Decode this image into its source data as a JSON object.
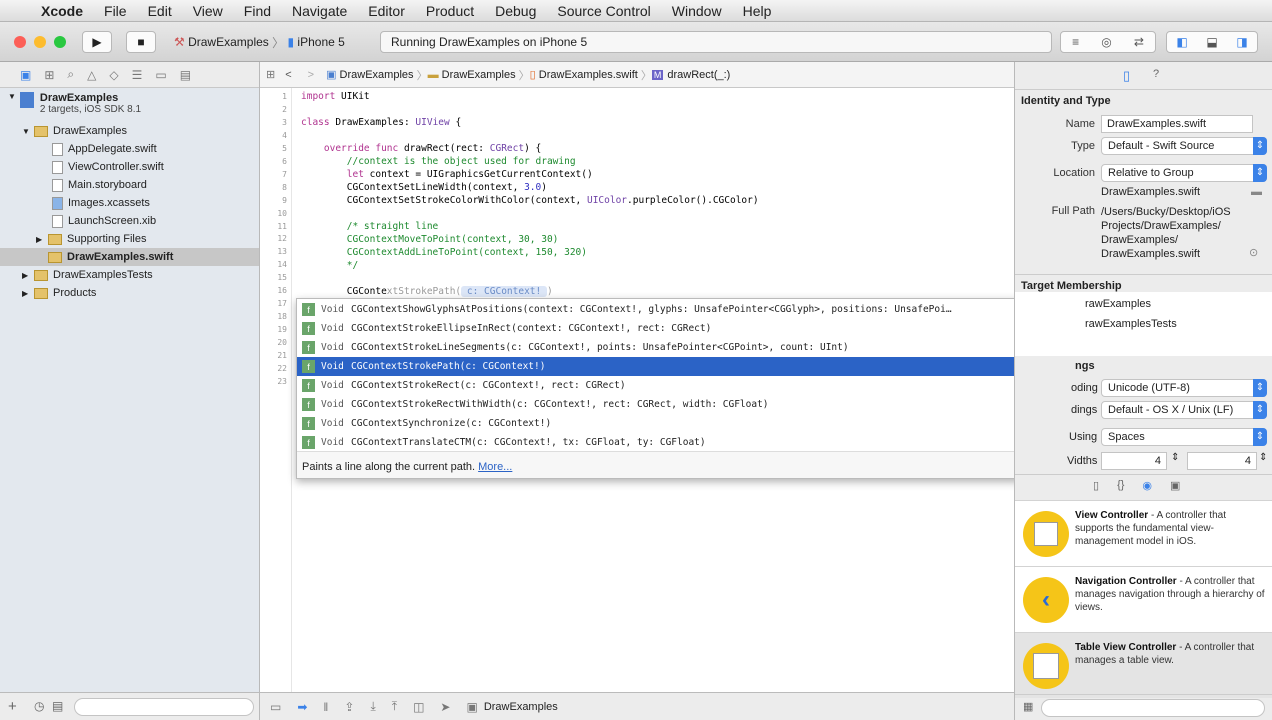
{
  "menubar": {
    "items": [
      "Xcode",
      "File",
      "Edit",
      "View",
      "Find",
      "Navigate",
      "Editor",
      "Product",
      "Debug",
      "Source Control",
      "Window",
      "Help"
    ]
  },
  "toolbar": {
    "scheme": "DrawExamples",
    "device": "iPhone 5",
    "status": "Running DrawExamples on iPhone 5"
  },
  "navigator": {
    "project": "DrawExamples",
    "project_sub": "2 targets, iOS SDK 8.1",
    "items": [
      {
        "label": "DrawExamples",
        "type": "folder"
      },
      {
        "label": "AppDelegate.swift",
        "type": "file"
      },
      {
        "label": "ViewController.swift",
        "type": "file"
      },
      {
        "label": "Main.storyboard",
        "type": "file"
      },
      {
        "label": "Images.xcassets",
        "type": "file"
      },
      {
        "label": "LaunchScreen.xib",
        "type": "file"
      },
      {
        "label": "Supporting Files",
        "type": "folder"
      },
      {
        "label": "DrawExamples.swift",
        "type": "file"
      },
      {
        "label": "DrawExamplesTests",
        "type": "folder"
      },
      {
        "label": "Products",
        "type": "folder"
      }
    ]
  },
  "jumpbar": [
    "DrawExamples",
    "DrawExamples",
    "DrawExamples.swift",
    "drawRect(_:)"
  ],
  "code": {
    "line_numbers": [
      "1",
      "2",
      "3",
      "4",
      "5",
      "6",
      "7",
      "8",
      "9",
      "10",
      "11",
      "12",
      "13",
      "14",
      "15",
      "16",
      "17",
      "18",
      "19",
      "20",
      "21",
      "22",
      "23"
    ],
    "l1a": "import",
    "l1b": " UIKit",
    "l3a": "class",
    "l3b": " DrawExamples: ",
    "l3c": "UIView",
    " l3d": " {",
    "l5a": "    override func",
    "l5b": " drawRect(rect: ",
    "l5c": "CGRect",
    "l5d": ") {",
    "l6": "        //context is the object used for drawing",
    "l7a": "        let",
    "l7b": " context = UIGraphicsGetCurrentContext()",
    "l8a": "        CGContextSetLineWidth(context, ",
    "l8b": "3.0",
    "l8c": ")",
    "l9a": "        CGContextSetStrokeColorWithColor(context, ",
    "l9b": "UIColor",
    "l9c": ".purpleColor().CGColor)",
    "l11": "        /* straight line",
    "l12": "        CGContextMoveToPoint(context, 30, 30)",
    "l13": "        CGContextAddLineToPoint(context, 150, 320)",
    "l14": "        */",
    "l16a": "        CGConte",
    "l16b": "xtStrokePath(",
    "l16c": " c: CGContext! ",
    "l16d": ")"
  },
  "autocomplete": {
    "items": [
      {
        "ret": "Void",
        "sig": "CGContextShowGlyphsAtPositions(context: CGContext!, glyphs: UnsafePointer<CGGlyph>, positions: UnsafePoi…"
      },
      {
        "ret": "Void",
        "sig": "CGContextStrokeEllipseInRect(context: CGContext!, rect: CGRect)"
      },
      {
        "ret": "Void",
        "sig": "CGContextStrokeLineSegments(c: CGContext!, points: UnsafePointer<CGPoint>, count: UInt)"
      },
      {
        "ret": "Void",
        "sig": "CGContextStrokePath(c: CGContext!)"
      },
      {
        "ret": "Void",
        "sig": "CGContextStrokeRect(c: CGContext!, rect: CGRect)"
      },
      {
        "ret": "Void",
        "sig": "CGContextStrokeRectWithWidth(c: CGContext!, rect: CGRect, width: CGFloat)"
      },
      {
        "ret": "Void",
        "sig": "CGContextSynchronize(c: CGContext!)"
      },
      {
        "ret": "Void",
        "sig": "CGContextTranslateCTM(c: CGContext!, tx: CGFloat, ty: CGFloat)"
      }
    ],
    "badge": "f",
    "description": "Paints a line along the current path.",
    "more": "More..."
  },
  "editor_bottom": {
    "target": "DrawExamples"
  },
  "inspector": {
    "identity_title": "Identity and Type",
    "name_label": "Name",
    "name": "DrawExamples.swift",
    "type_label": "Type",
    "type": "Default - Swift Source",
    "location_label": "Location",
    "location": "Relative to Group",
    "location_file": "DrawExamples.swift",
    "fullpath_label": "Full Path",
    "fullpath": [
      "/Users/Bucky/Desktop/iOS",
      "Projects/DrawExamples/",
      "DrawExamples/",
      "DrawExamples.swift"
    ],
    "target_title": "Target Membership",
    "targets": [
      "rawExamples",
      "rawExamplesTests"
    ],
    "text_title": "ngs",
    "encoding_label": "oding",
    "encoding": "Unicode (UTF-8)",
    "endings_label": "dings",
    "endings": "Default - OS X / Unix (LF)",
    "indent_label": "Using",
    "indent": "Spaces",
    "widths_label": "Vidths",
    "tab_width": "4",
    "indent_width": "4"
  },
  "library": [
    {
      "title": "View Controller",
      "desc": " - A controller that supports the fundamental view-management model in iOS."
    },
    {
      "title": "Navigation Controller",
      "desc": " - A controller that manages navigation through a hierarchy of views."
    },
    {
      "title": "Table View Controller",
      "desc": " - A controller that manages a table view."
    }
  ]
}
